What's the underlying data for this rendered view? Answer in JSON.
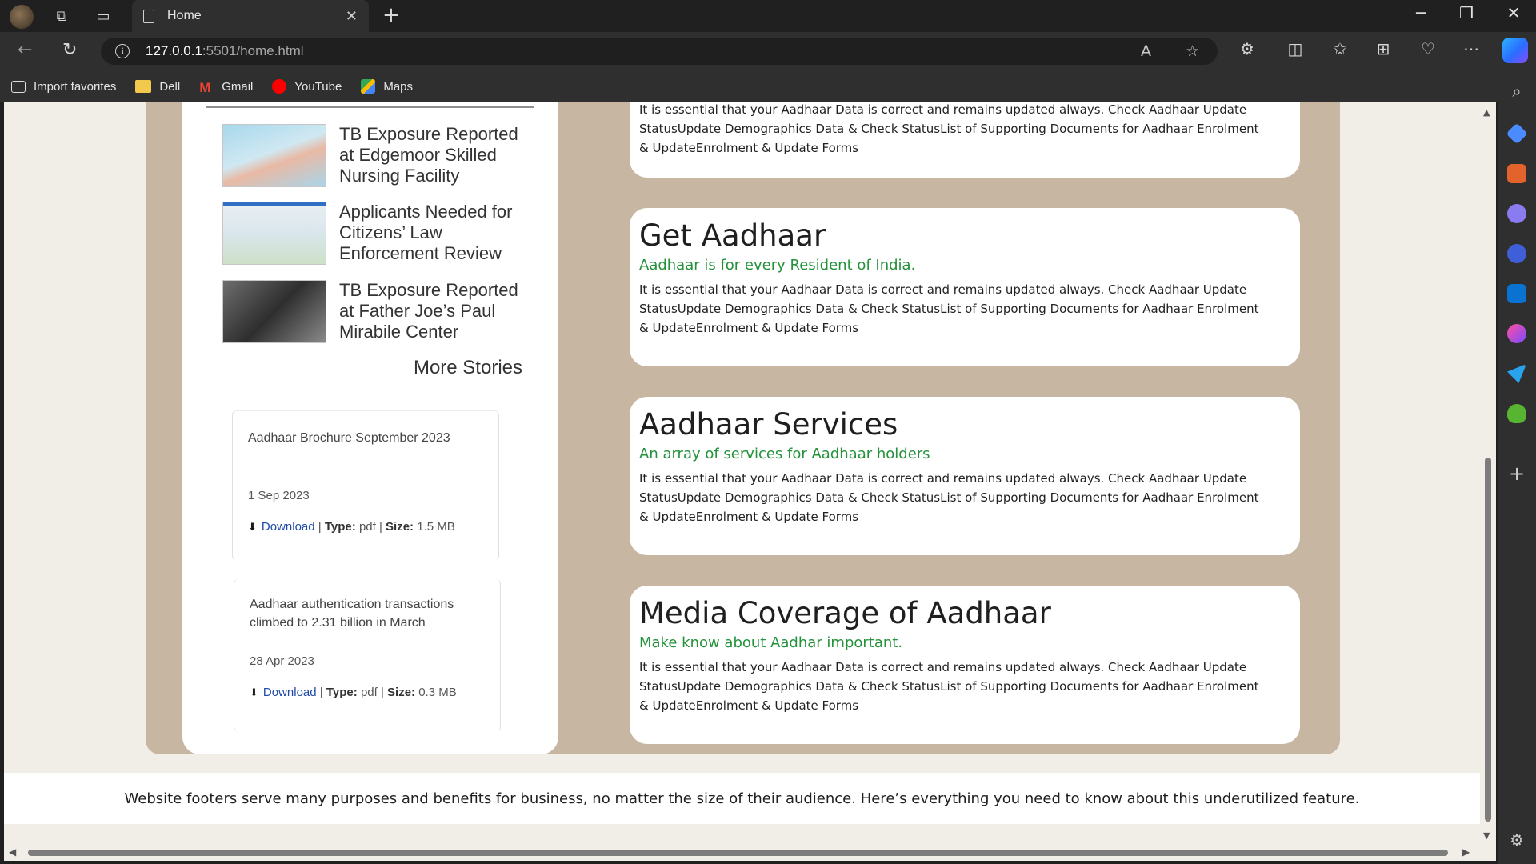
{
  "browser": {
    "tab_title": "Home",
    "url_host": "127.0.0.1",
    "url_path": ":5501/home.html",
    "bookmarks": [
      {
        "label": "Import favorites",
        "icon": "import-icon"
      },
      {
        "label": "Dell",
        "icon": "folder-icon",
        "color": "#f2c94c"
      },
      {
        "label": "Gmail",
        "icon": "gmail-icon",
        "color": "#ea4335"
      },
      {
        "label": "YouTube",
        "icon": "youtube-icon",
        "color": "#ff0000"
      },
      {
        "label": "Maps",
        "icon": "maps-icon",
        "color": "#34a853"
      }
    ]
  },
  "news": {
    "stories": [
      {
        "title": "TB Exposure Reported at Edgemoor Skilled Nursing Facility",
        "thumb": "arm-ruler-thumbnail"
      },
      {
        "title": "Applicants Needed for Citizens’ Law Enforcement Review",
        "thumb": "map-thumbnail"
      },
      {
        "title": "TB Exposure Reported at Father Joe’s Paul Mirabile Center",
        "thumb": "stethoscope-tuberculosis-thumbnail"
      }
    ],
    "more_label": "More Stories"
  },
  "documents": [
    {
      "title": "Aadhaar Brochure September 2023",
      "date": "1 Sep 2023",
      "download": "Download",
      "type_label": "Type:",
      "type": "pdf",
      "size_label": "Size:",
      "size": "1.5 MB"
    },
    {
      "title": "Aadhaar authentication transactions climbed to 2.31 billion in March",
      "date": "28 Apr 2023",
      "download": "Download",
      "type_label": "Type:",
      "type": "pdf",
      "size_label": "Size:",
      "size": "0.3 MB"
    }
  ],
  "cards": [
    {
      "title": "",
      "subtitle": "",
      "body": "It is essential that your Aadhaar Data is correct and remains updated always. Check Aadhaar Update StatusUpdate Demographics Data & Check StatusList of Supporting Documents for Aadhaar Enrolment & UpdateEnrolment & Update Forms"
    },
    {
      "title": "Get Aadhaar",
      "subtitle": "Aadhaar is for every Resident of India.",
      "body": "It is essential that your Aadhaar Data is correct and remains updated always. Check Aadhaar Update StatusUpdate Demographics Data & Check StatusList of Supporting Documents for Aadhaar Enrolment & UpdateEnrolment & Update Forms"
    },
    {
      "title": "Aadhaar Services",
      "subtitle": "An array of services for Aadhaar holders",
      "body": "It is essential that your Aadhaar Data is correct and remains updated always. Check Aadhaar Update StatusUpdate Demographics Data & Check StatusList of Supporting Documents for Aadhaar Enrolment & UpdateEnrolment & Update Forms"
    },
    {
      "title": "Media Coverage of Aadhaar",
      "subtitle": "Make know about Aadhar important.",
      "body": "It is essential that your Aadhaar Data is correct and remains updated always. Check Aadhaar Update StatusUpdate Demographics Data & Check StatusList of Supporting Documents for Aadhaar Enrolment & UpdateEnrolment & Update Forms"
    }
  ],
  "footer": {
    "text": "Website footers serve many purposes and benefits for business, no matter the size of their audience. Here’s everything you need to know about this underutilized feature."
  },
  "colors": {
    "panel_bg": "#c6b6a2",
    "page_bg": "#f1ede7",
    "subtitle_green": "#23923a",
    "download_blue": "#1f4aa8"
  }
}
